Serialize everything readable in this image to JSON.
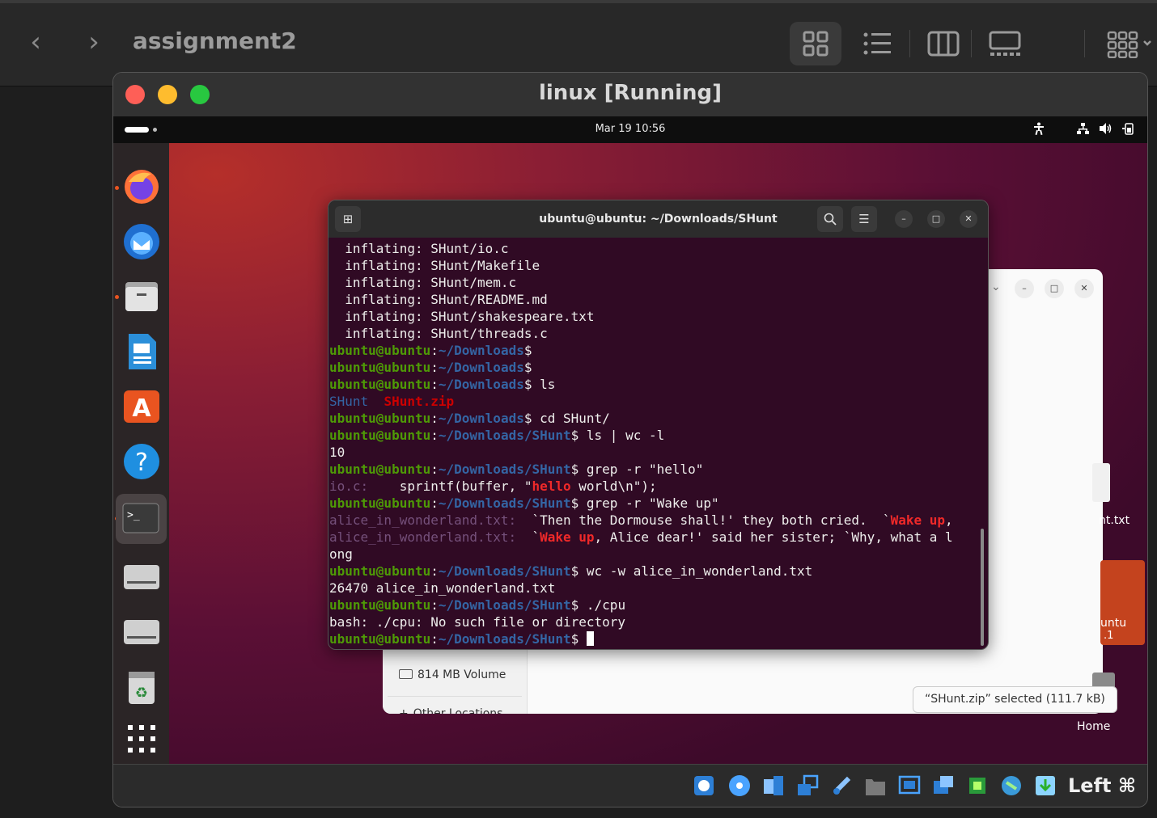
{
  "finder": {
    "title": "assignment2",
    "back_icon": "chevron-left-icon",
    "forward_icon": "chevron-right-icon"
  },
  "vm": {
    "title": "linux [Running]",
    "host_key": "Left ⌘"
  },
  "ubuntu": {
    "clock": "Mar 19  10:56"
  },
  "terminal": {
    "title": "ubuntu@ubuntu: ~/Downloads/SHunt",
    "prompt_user": "ubuntu@ubuntu",
    "lines": [
      "  inflating: SHunt/io.c",
      "  inflating: SHunt/Makefile",
      "  inflating: SHunt/mem.c",
      "  inflating: SHunt/README.md",
      "  inflating: SHunt/shakespeare.txt",
      "  inflating: SHunt/threads.c"
    ],
    "ls_dir": "SHunt",
    "ls_zip": "SHunt.zip",
    "cmd_ls": "ls",
    "cmd_cd": "cd SHunt/",
    "cmd_wc_l": "ls | wc -l",
    "out_count": "10",
    "cmd_grep_hello": "grep -r \"hello\"",
    "grep_hello_file": "io.c:",
    "grep_hello_pre": "    sprintf(buffer, \"",
    "grep_hello_match": "hello",
    "grep_hello_post": " world\\n\");",
    "cmd_grep_wake": "grep -r \"Wake up\"",
    "wake_file": "alice_in_wonderland.txt:",
    "wake1_pre": "  `Then the Dormouse shall!' they both cried.  `",
    "wake_match": "Wake up",
    "wake1_post": ",",
    "wake2_pre": "  `",
    "wake2_post": ", Alice dear!' said her sister; `Why, what a l",
    "wake2_wrap": "ong",
    "cmd_wc_w": "wc -w alice_in_wonderland.txt",
    "out_wc_w": "26470 alice_in_wonderland.txt",
    "cmd_cpu": "./cpu",
    "out_cpu": "bash: ./cpu: No such file or directory",
    "path_downloads": "~/Downloads",
    "path_shunt": "~/Downloads/SHunt"
  },
  "files": {
    "sidebar_volume": "814 MB Volume",
    "sidebar_other": "Other Locations",
    "status": "“SHunt.zip” selected  (111.7 kB)",
    "desktop_item_txt": "nt.txt",
    "desktop_item_ubuntu": "untu",
    "desktop_item_ubuntu2": ".1",
    "desktop_home": "Home"
  }
}
